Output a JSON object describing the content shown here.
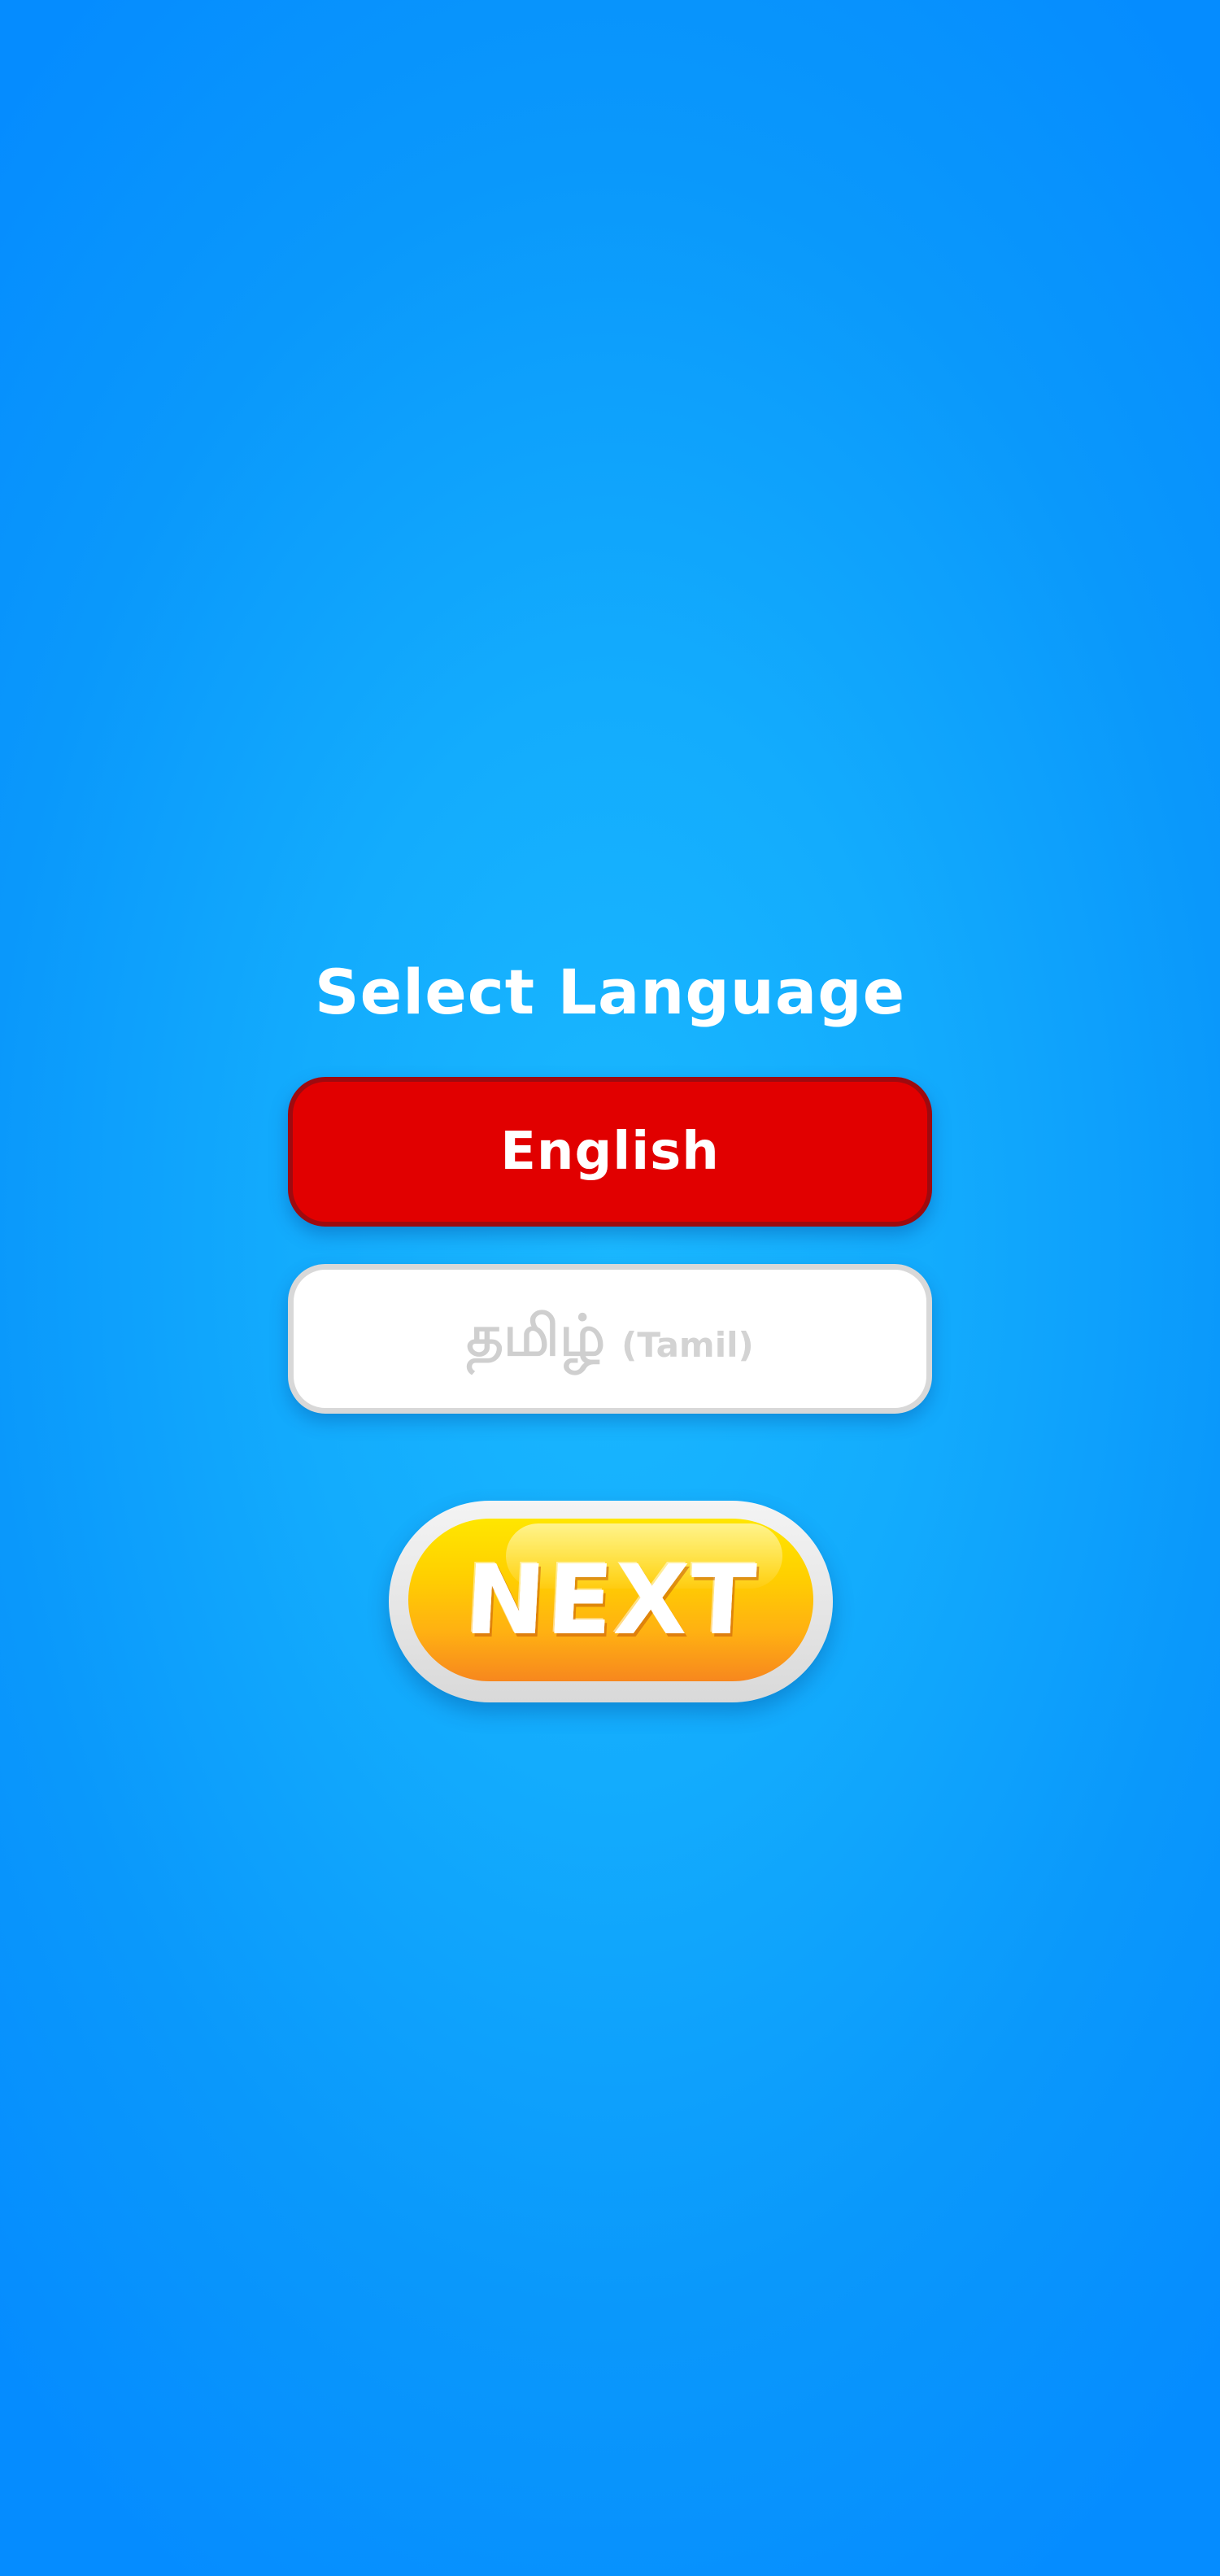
{
  "screen": {
    "title": "Select Language"
  },
  "languages": [
    {
      "label": "English",
      "selected": true
    },
    {
      "native_label": "தமிழ்",
      "roman_label": "(Tamil)",
      "selected": false
    }
  ],
  "next_button": {
    "label": "NEXT"
  },
  "colors": {
    "background": "#13acfd",
    "selected_button": "#e10000",
    "unselected_button": "#ffffff",
    "next_button_top": "#ffe600",
    "next_button_bottom": "#f7871e"
  }
}
